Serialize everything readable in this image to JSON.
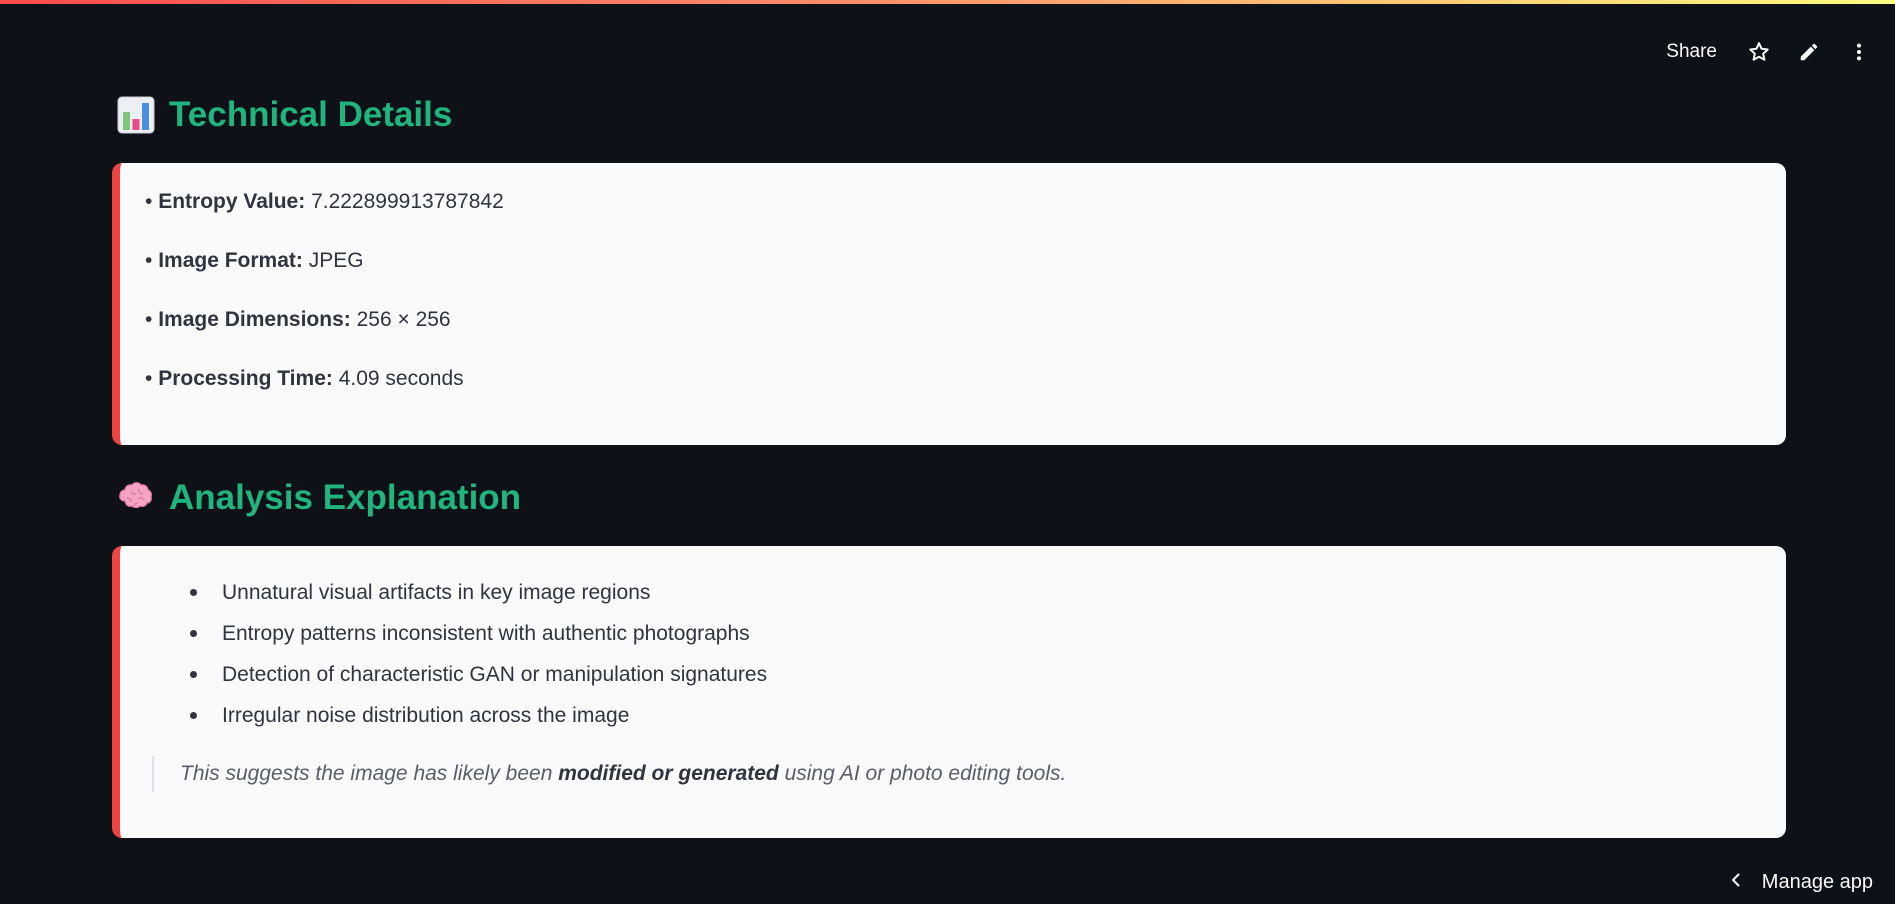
{
  "toolbar": {
    "share_label": "Share",
    "icons": [
      "star-icon",
      "pencil-icon",
      "more-vertical-icon"
    ]
  },
  "technical": {
    "title": "Technical Details",
    "icon": "bar-chart-emoji",
    "items": [
      {
        "label": "Entropy Value:",
        "value": "7.222899913787842"
      },
      {
        "label": "Image Format:",
        "value": "JPEG"
      },
      {
        "label": "Image Dimensions:",
        "value": "256 × 256"
      },
      {
        "label": "Processing Time:",
        "value": "4.09 seconds"
      }
    ]
  },
  "analysis": {
    "title": "Analysis Explanation",
    "icon": "brain-emoji",
    "bullets": [
      "Unnatural visual artifacts in key image regions",
      "Entropy patterns inconsistent with authentic photographs",
      "Detection of characteristic GAN or manipulation signatures",
      "Irregular noise distribution across the image"
    ],
    "quote": {
      "before": "This suggests the image has likely been ",
      "emphasis": "modified or generated",
      "after": " using AI or photo editing tools."
    }
  },
  "footer": {
    "manage_label": "Manage app"
  },
  "colors": {
    "background": "#0e1117",
    "heading": "#1fb57e",
    "card": "#f8fafc",
    "card_accent": "#ef4444",
    "text": "#31333f"
  }
}
